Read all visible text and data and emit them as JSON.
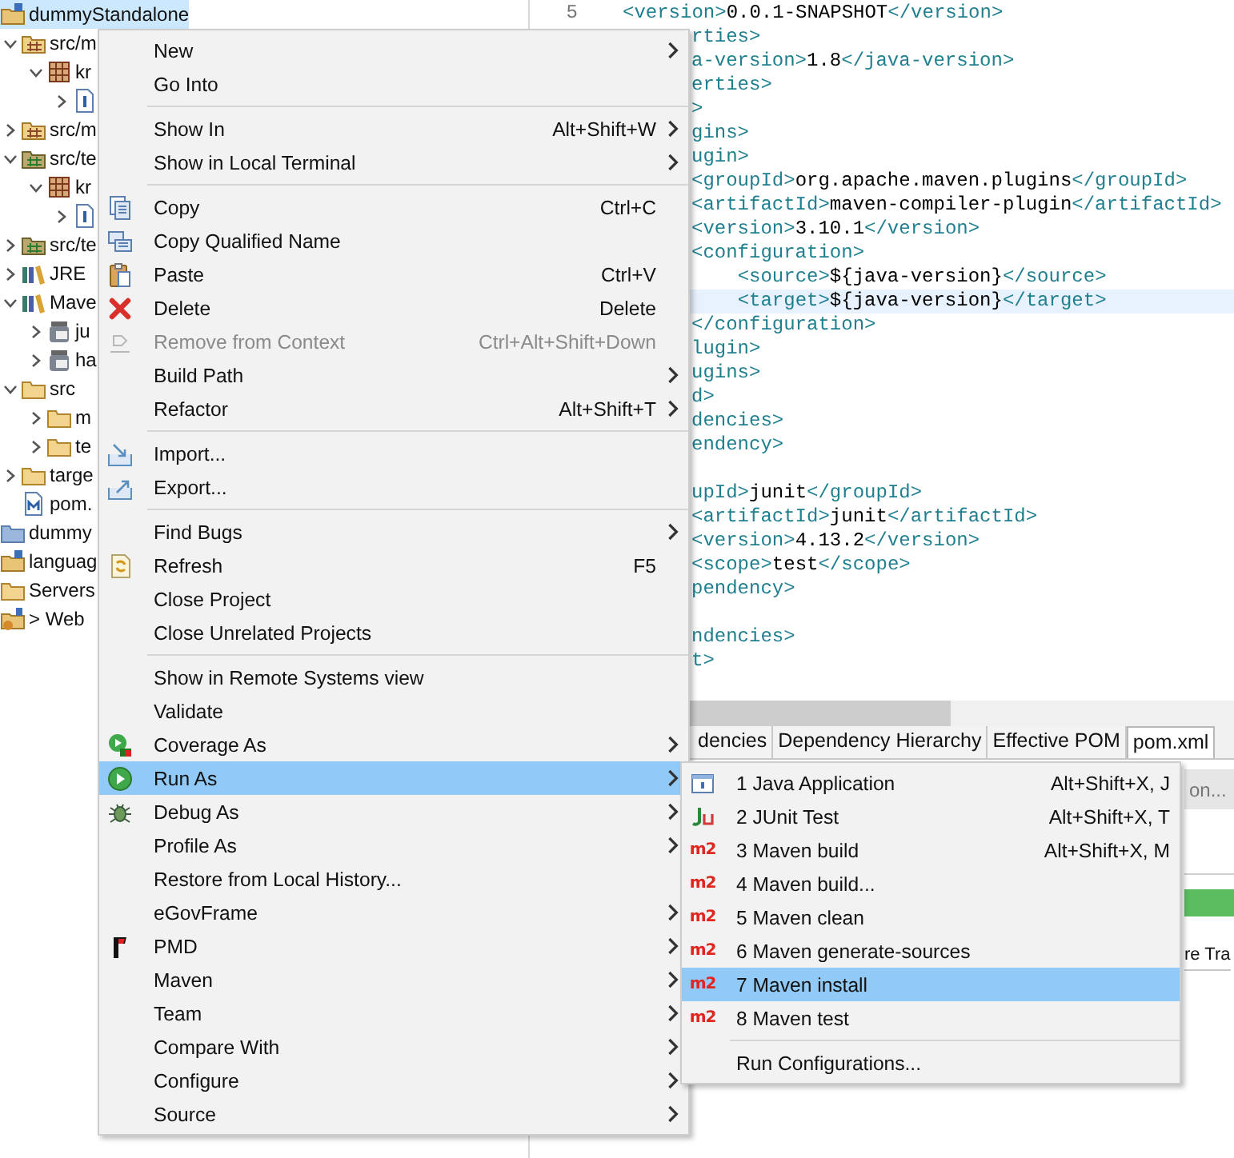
{
  "project_explorer": {
    "nodes": [
      {
        "label": "dummyStandalone",
        "kind": "project",
        "selected": true,
        "children": [
          {
            "label": "src/m",
            "kind": "source-folder",
            "expanded": true,
            "selected": false,
            "children": [
              {
                "label": "kr",
                "kind": "package",
                "expanded": true,
                "selected": false,
                "children": [
                  {
                    "kind": "java-file",
                    "expanded": false,
                    "selected": false
                  }
                ]
              }
            ]
          },
          {
            "label": "src/m",
            "kind": "source-folder",
            "expanded": false,
            "selected": false
          },
          {
            "label": "src/te",
            "kind": "test-folder",
            "expanded": true,
            "selected": false,
            "children": [
              {
                "label": "kr",
                "kind": "package",
                "expanded": true,
                "selected": false,
                "children": [
                  {
                    "kind": "java-file",
                    "expanded": false,
                    "selected": false
                  }
                ]
              }
            ]
          },
          {
            "label": "src/te",
            "kind": "test-folder",
            "expanded": false,
            "selected": false
          },
          {
            "label": "JRE",
            "kind": "library",
            "expanded": false,
            "selected": false
          },
          {
            "label": "Mave",
            "kind": "library",
            "expanded": true,
            "selected": false,
            "children": [
              {
                "label": "ju",
                "kind": "jar",
                "expanded": false,
                "selected": false
              },
              {
                "label": "ha",
                "kind": "jar",
                "expanded": false,
                "selected": false
              }
            ]
          },
          {
            "label": "src",
            "kind": "folder",
            "expanded": true,
            "selected": false,
            "children": [
              {
                "label": "m",
                "kind": "folder",
                "expanded": false,
                "selected": false
              },
              {
                "label": "te",
                "kind": "folder",
                "expanded": false,
                "selected": false
              }
            ]
          },
          {
            "label": "targe",
            "kind": "folder",
            "expanded": false,
            "selected": false
          },
          {
            "label": "pom.",
            "kind": "pom-file",
            "selected": false
          }
        ]
      },
      {
        "label": "dummy",
        "kind": "closed-project",
        "selected": false
      },
      {
        "label": "languag",
        "kind": "project",
        "selected": false
      },
      {
        "label": "Servers",
        "kind": "folder",
        "selected": false
      },
      {
        "label": "> Web",
        "kind": "web-project",
        "selected": false
      }
    ]
  },
  "editor": {
    "lines": [
      {
        "number": "5",
        "text": "<version>0.0.1-SNAPSHOT</version>",
        "current": false
      },
      {
        "text": "rties>",
        "current": false
      },
      {
        "text": "a-version>1.8</java-version>",
        "current": false
      },
      {
        "text": "erties>",
        "current": false
      },
      {
        "text": ">",
        "current": false
      },
      {
        "text": "gins>",
        "current": false
      },
      {
        "text": "ugin>",
        "current": false
      },
      {
        "text": "<groupId>org.apache.maven.plugins</groupId>",
        "current": false
      },
      {
        "text": "<artifactId>maven-compiler-plugin</artifactId>",
        "current": false
      },
      {
        "text": "<version>3.10.1</version>",
        "current": false
      },
      {
        "text": "<configuration>",
        "current": false
      },
      {
        "text": "    <source>${java-version}</source>",
        "current": false
      },
      {
        "text": "    <target>${java-version}</target>",
        "current": true
      },
      {
        "text": "</configuration>",
        "current": false
      },
      {
        "text": "lugin>",
        "current": false
      },
      {
        "text": "ugins>",
        "current": false
      },
      {
        "text": "d>",
        "current": false
      },
      {
        "text": "dencies>",
        "current": false
      },
      {
        "text": "endency>",
        "current": false
      },
      {
        "current": false
      },
      {
        "text": "upId>junit</groupId>",
        "current": false
      },
      {
        "text": "<artifactId>junit</artifactId>",
        "current": false
      },
      {
        "text": "<version>4.13.2</version>",
        "current": false
      },
      {
        "text": "<scope>test</scope>",
        "current": false
      },
      {
        "text": "pendency>",
        "current": false
      },
      {
        "current": false
      },
      {
        "text": "ndencies>",
        "current": false
      },
      {
        "text": "t>",
        "current": false
      }
    ],
    "tabs": [
      {
        "label": "dencies",
        "selected": false
      },
      {
        "label": "Dependency Hierarchy",
        "selected": false
      },
      {
        "label": "Effective POM",
        "selected": false
      },
      {
        "label": "pom.xml",
        "selected": true
      }
    ],
    "lower_panel": {
      "button_text": "on...",
      "column_text": "re Tra"
    }
  },
  "context_menu": {
    "items": [
      {
        "kind": "item",
        "label": "New",
        "submenu": true,
        "disabled": false,
        "selected": false
      },
      {
        "kind": "item",
        "label": "Go Into",
        "submenu": false,
        "disabled": false,
        "selected": false
      },
      {
        "kind": "separator"
      },
      {
        "kind": "item",
        "label": "Show In",
        "shortcut": "Alt+Shift+W",
        "submenu": true,
        "disabled": false,
        "selected": false
      },
      {
        "kind": "item",
        "label": "Show in Local Terminal",
        "submenu": true,
        "disabled": false,
        "selected": false
      },
      {
        "kind": "separator"
      },
      {
        "kind": "item",
        "label": "Copy",
        "shortcut": "Ctrl+C",
        "submenu": false,
        "disabled": false,
        "selected": false
      },
      {
        "kind": "item",
        "label": "Copy Qualified Name",
        "submenu": false,
        "disabled": false,
        "selected": false
      },
      {
        "kind": "item",
        "label": "Paste",
        "shortcut": "Ctrl+V",
        "submenu": false,
        "disabled": false,
        "selected": false
      },
      {
        "kind": "item",
        "label": "Delete",
        "shortcut": "Delete",
        "submenu": false,
        "disabled": false,
        "selected": false
      },
      {
        "kind": "item",
        "label": "Remove from Context",
        "shortcut": "Ctrl+Alt+Shift+Down",
        "submenu": false,
        "disabled": true,
        "selected": false
      },
      {
        "kind": "item",
        "label": "Build Path",
        "submenu": true,
        "disabled": false,
        "selected": false
      },
      {
        "kind": "item",
        "label": "Refactor",
        "shortcut": "Alt+Shift+T",
        "submenu": true,
        "disabled": false,
        "selected": false
      },
      {
        "kind": "separator"
      },
      {
        "kind": "item",
        "label": "Import...",
        "submenu": false,
        "disabled": false,
        "selected": false
      },
      {
        "kind": "item",
        "label": "Export...",
        "submenu": false,
        "disabled": false,
        "selected": false
      },
      {
        "kind": "separator"
      },
      {
        "kind": "item",
        "label": "Find Bugs",
        "submenu": true,
        "disabled": false,
        "selected": false
      },
      {
        "kind": "item",
        "label": "Refresh",
        "shortcut": "F5",
        "submenu": false,
        "disabled": false,
        "selected": false
      },
      {
        "kind": "item",
        "label": "Close Project",
        "submenu": false,
        "disabled": false,
        "selected": false
      },
      {
        "kind": "item",
        "label": "Close Unrelated Projects",
        "submenu": false,
        "disabled": false,
        "selected": false
      },
      {
        "kind": "separator"
      },
      {
        "kind": "item",
        "label": "Show in Remote Systems view",
        "submenu": false,
        "disabled": false,
        "selected": false
      },
      {
        "kind": "item",
        "label": "Validate",
        "submenu": false,
        "disabled": false,
        "selected": false
      },
      {
        "kind": "item",
        "label": "Coverage As",
        "submenu": true,
        "disabled": false,
        "selected": false
      },
      {
        "kind": "item",
        "label": "Run As",
        "submenu": true,
        "disabled": false,
        "selected": true
      },
      {
        "kind": "item",
        "label": "Debug As",
        "submenu": true,
        "disabled": false,
        "selected": false
      },
      {
        "kind": "item",
        "label": "Profile As",
        "submenu": true,
        "disabled": false,
        "selected": false
      },
      {
        "kind": "item",
        "label": "Restore from Local History...",
        "submenu": false,
        "disabled": false,
        "selected": false
      },
      {
        "kind": "item",
        "label": "eGovFrame",
        "submenu": true,
        "disabled": false,
        "selected": false
      },
      {
        "kind": "item",
        "label": "PMD",
        "submenu": true,
        "disabled": false,
        "selected": false
      },
      {
        "kind": "item",
        "label": "Maven",
        "submenu": true,
        "disabled": false,
        "selected": false
      },
      {
        "kind": "item",
        "label": "Team",
        "submenu": true,
        "disabled": false,
        "selected": false
      },
      {
        "kind": "item",
        "label": "Compare With",
        "submenu": true,
        "disabled": false,
        "selected": false
      },
      {
        "kind": "item",
        "label": "Configure",
        "submenu": true,
        "disabled": false,
        "selected": false
      },
      {
        "kind": "item",
        "label": "Source",
        "submenu": true,
        "disabled": false,
        "selected": false
      }
    ]
  },
  "run_as_menu": {
    "items": [
      {
        "kind": "item",
        "label": "1 Java Application",
        "shortcut": "Alt+Shift+X, J",
        "selected": false
      },
      {
        "kind": "item",
        "label": "2 JUnit Test",
        "shortcut": "Alt+Shift+X, T",
        "selected": false
      },
      {
        "kind": "item",
        "label": "3 Maven build",
        "shortcut": "Alt+Shift+X, M",
        "badge": "m2",
        "selected": false
      },
      {
        "kind": "item",
        "label": "4 Maven build...",
        "badge": "m2",
        "selected": false
      },
      {
        "kind": "item",
        "label": "5 Maven clean",
        "badge": "m2",
        "selected": false
      },
      {
        "kind": "item",
        "label": "6 Maven generate-sources",
        "badge": "m2",
        "selected": false
      },
      {
        "kind": "item",
        "label": "7 Maven install",
        "badge": "m2",
        "selected": true
      },
      {
        "kind": "item",
        "label": "8 Maven test",
        "badge": "m2",
        "selected": false
      },
      {
        "kind": "separator"
      },
      {
        "kind": "item",
        "label": "Run Configurations...",
        "selected": false
      }
    ]
  }
}
